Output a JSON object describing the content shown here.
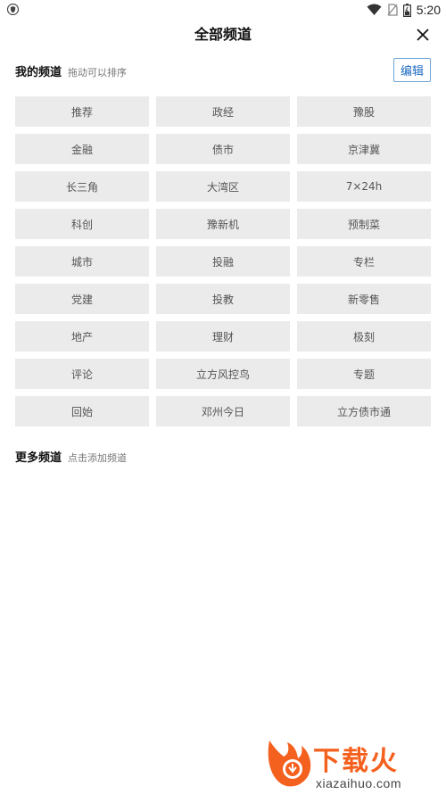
{
  "status_bar": {
    "time": "5:20",
    "left_icon": "shield-icon",
    "right_icons": [
      "wifi-icon",
      "no-sim-icon",
      "battery-icon"
    ]
  },
  "header": {
    "title": "全部频道",
    "close_icon": "close-icon"
  },
  "my_channels": {
    "title": "我的频道",
    "hint": "拖动可以排序",
    "edit_label": "编辑",
    "items": [
      "推荐",
      "政经",
      "豫股",
      "金融",
      "债市",
      "京津冀",
      "长三角",
      "大湾区",
      "7×24h",
      "科创",
      "豫新机",
      "预制菜",
      "城市",
      "投融",
      "专栏",
      "党建",
      "投教",
      "新零售",
      "地产",
      "理财",
      "极刻",
      "评论",
      "立方风控鸟",
      "专题",
      "回始",
      "邓州今日",
      "立方债市通"
    ]
  },
  "more_channels": {
    "title": "更多频道",
    "hint": "点击添加频道"
  },
  "watermark": {
    "text": "下载火",
    "url": "xiazaihuo.com",
    "accent": "#f4601d"
  },
  "colors": {
    "chip_bg": "#ebebeb",
    "edit_border": "#6fa3d6",
    "edit_text": "#1e6bc2"
  }
}
